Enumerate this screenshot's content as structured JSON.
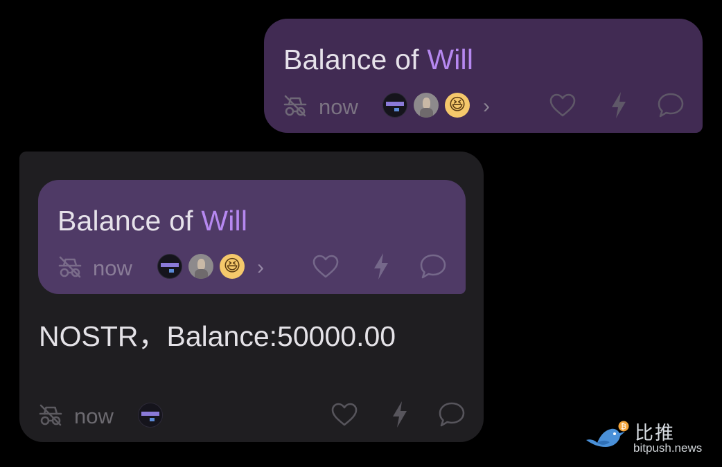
{
  "outgoing_message": {
    "text_prefix": "Balance of ",
    "mention": "Will",
    "time": "now",
    "more_chevron": "›"
  },
  "incoming_message": {
    "quoted": {
      "text_prefix": "Balance of ",
      "mention": "Will",
      "time": "now",
      "more_chevron": "›"
    },
    "text": "NOSTR，Balance:50000.00",
    "time": "now"
  },
  "reaction_avatars": [
    "dark-banner-avatar",
    "grey-figure-avatar",
    "laughing-emoji-avatar"
  ],
  "icons": {
    "anonymous": "incognito-off-icon",
    "like": "heart-icon",
    "zap": "lightning-icon",
    "reply": "chat-bubble-icon"
  },
  "colors": {
    "outgoing_bubble": "#412b53",
    "quote_bubble": "#4f3a66",
    "incoming_bubble": "#1f1e21",
    "mention": "#b688f0"
  },
  "watermark": {
    "chinese": "比推",
    "url": "bitpush.news",
    "coin_symbol": "₿"
  }
}
